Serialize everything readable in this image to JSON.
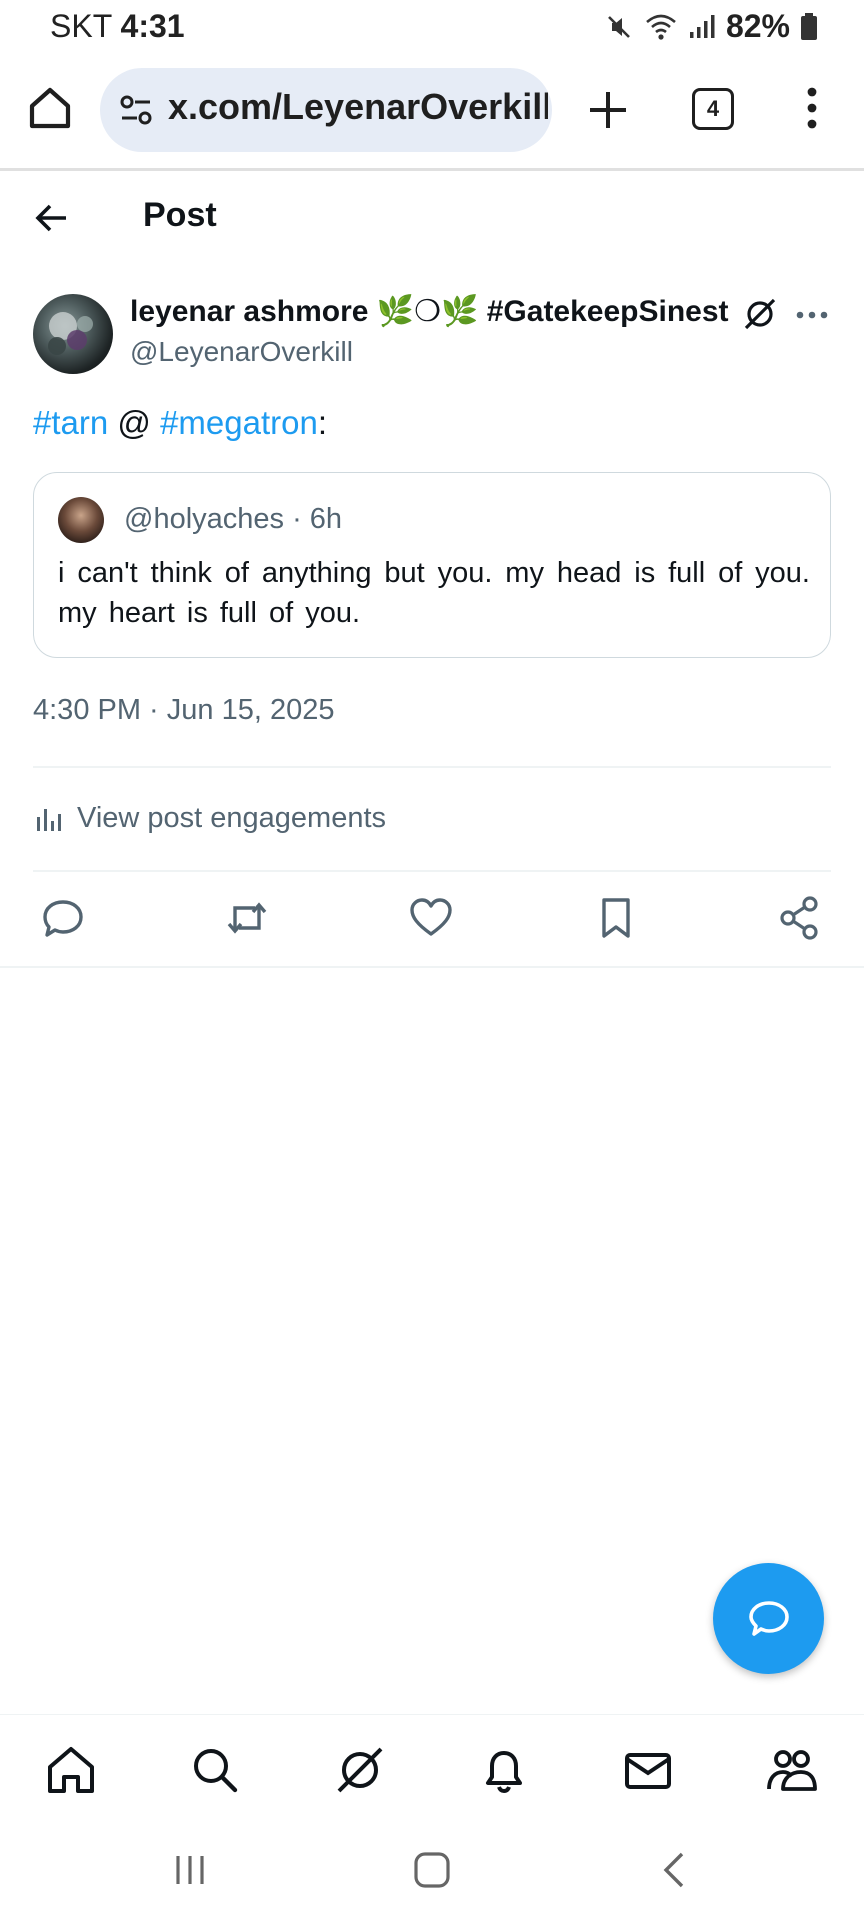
{
  "status_bar": {
    "carrier": "SKT",
    "time": "4:31",
    "battery": "82%",
    "icons": [
      "mute-icon",
      "wifi-icon",
      "signal-icon",
      "battery-icon"
    ]
  },
  "browser": {
    "url": "x.com/LeyenarOverkill/",
    "tab_count": "4",
    "icons": [
      "home-icon",
      "site-settings-icon",
      "plus-icon",
      "tabs-icon",
      "more-vertical-icon"
    ]
  },
  "post_header": {
    "title": "Post"
  },
  "author": {
    "name": "leyenar ashmore 🌿❍🌿 #GatekeepSinestr...",
    "handle": "@LeyenarOverkill"
  },
  "post": {
    "hashtag1": "#tarn",
    "at": " @ ",
    "hashtag2": "#megatron",
    "colon": ":"
  },
  "quote": {
    "header": "@holyaches · 6h",
    "text": "i can't think of anything but you. my head is full of you. my heart is full of you."
  },
  "timestamp": "4:30 PM · Jun 15, 2025",
  "engagements_label": "View post engagements",
  "colors": {
    "accent": "#1d9bf0",
    "secondary_text": "#536471",
    "primary_text": "#0f1419",
    "url_pill": "#e6ecf6"
  }
}
